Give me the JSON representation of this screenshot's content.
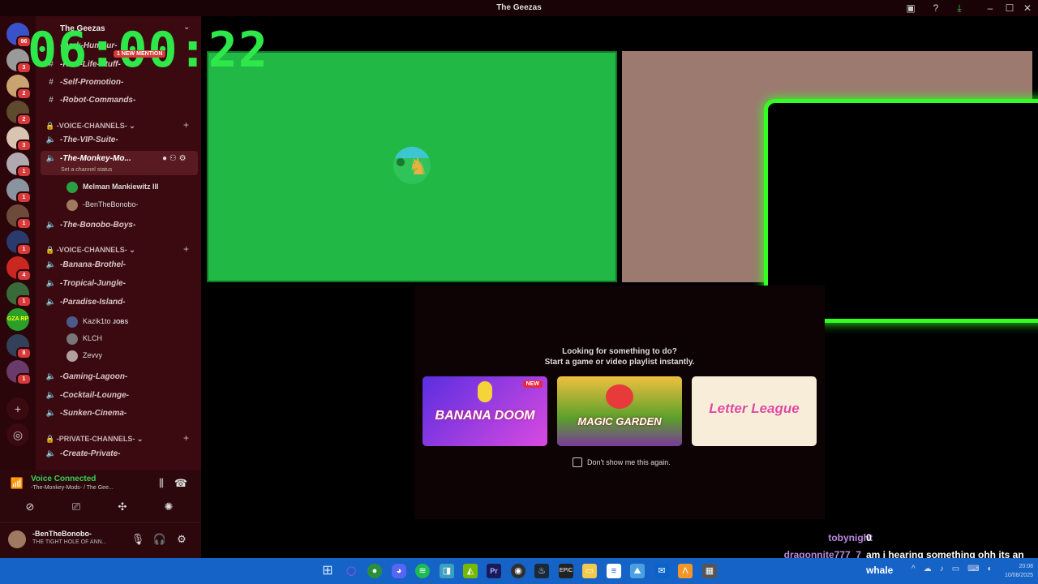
{
  "window": {
    "title": "The Geezas",
    "minimize": "–",
    "maximize": "☐",
    "close": "✕"
  },
  "timer": "06:00:22",
  "servers": [
    {
      "badge": "96",
      "color": "#3a52c9"
    },
    {
      "badge": "3",
      "color": "#9a9a9a"
    },
    {
      "badge": "2",
      "color": "#caa470"
    },
    {
      "badge": "2",
      "color": "#5e4a2d"
    },
    {
      "badge": "3",
      "color": "#d9c4b2"
    },
    {
      "badge": "1",
      "color": "#b0aab0"
    },
    {
      "badge": "1",
      "color": "#8a94a0"
    },
    {
      "badge": "1",
      "color": "#6d4a3a"
    },
    {
      "badge": "1",
      "color": "#2a3a6a"
    },
    {
      "badge": "4",
      "color": "#c9271f"
    },
    {
      "badge": "1",
      "color": "#3a6a3a"
    },
    {
      "badge": "",
      "color": "#2aa02a",
      "text": "GZA RP"
    },
    {
      "badge": "8",
      "color": "#33405a"
    },
    {
      "badge": "1",
      "color": "#6a3a6a"
    }
  ],
  "server_name": "The Geezas",
  "new_mentions": "1 NEW MENTION",
  "text_channels": [
    {
      "name": "-Dark-Humour-"
    },
    {
      "name": "-Real-Life-Stuff-"
    },
    {
      "name": "-Self-Promotion-"
    },
    {
      "name": "-Robot-Commands-"
    }
  ],
  "categories": {
    "voice1": "-VOICE-CHANNELS-",
    "voice2": "-VOICE-CHANNELS-",
    "private": "-PRIVATE-CHANNELS-"
  },
  "voice_channels_1": [
    {
      "name": "-The-VIP-Suite-"
    },
    {
      "name": "-The-Monkey-Mo...",
      "status": "Set a channel status"
    },
    {
      "name": "-The-Bonobo-Boys-"
    }
  ],
  "monkey_users": [
    {
      "name": "Melman Mankiewitz III"
    },
    {
      "name": "-BenTheBonobo-"
    }
  ],
  "voice_channels_2": [
    {
      "name": "-Banana-Brothel-"
    },
    {
      "name": "-Tropical-Jungle-"
    },
    {
      "name": "-Paradise-Island-"
    }
  ],
  "paradise_users": [
    {
      "name": "Kazik1to",
      "tag": "JOBS"
    },
    {
      "name": "KLCH"
    },
    {
      "name": "Zevvy"
    }
  ],
  "voice_channels_3": [
    {
      "name": "-Gaming-Lagoon-"
    },
    {
      "name": "-Cocktail-Lounge-"
    },
    {
      "name": "-Sunken-Cinema-"
    }
  ],
  "private_channels": [
    {
      "name": "-Create-Private-"
    }
  ],
  "voice_status": {
    "label": "Voice Connected",
    "channel": "-The-Monkey-Mods- / The Gee..."
  },
  "user": {
    "name": "-BenTheBonobo-",
    "status": "THE TIGHT HOLE OF ANN..."
  },
  "activity": {
    "line1": "Looking for something to do?",
    "line2": "Start a game or video playlist instantly.",
    "cards": [
      {
        "title": "BANANA DOOM",
        "badge": "NEW"
      },
      {
        "title": "MAGIC GARDEN"
      },
      {
        "title": "Letter League"
      }
    ],
    "dont_show": "Don't show me this again."
  },
  "chat": [
    {
      "user": "tobynight",
      "message": "0",
      "color": "#b98be0"
    },
    {
      "user": "dragonnite777_7",
      "message": "am i hearing something ohh its an",
      "color": "#b98be0"
    }
  ],
  "chat_tail": "whale",
  "taskbar": {
    "time": "20:08",
    "date": "10/08/2025"
  }
}
